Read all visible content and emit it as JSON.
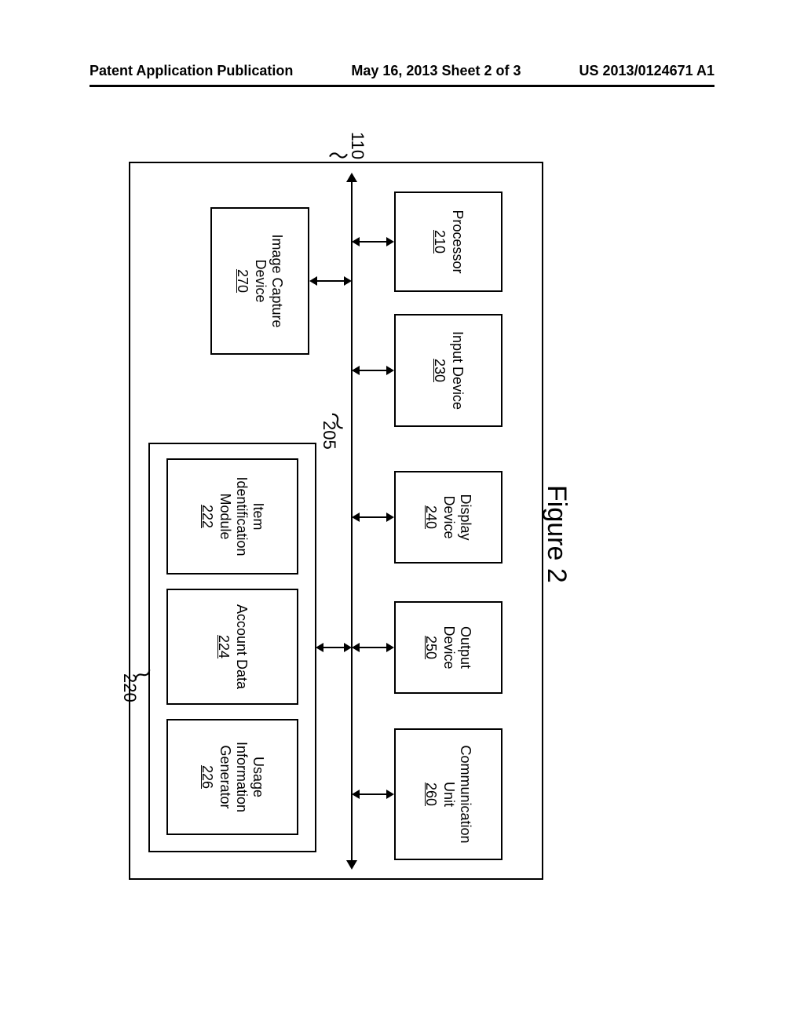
{
  "header": {
    "left": "Patent Application Publication",
    "center": "May 16, 2013  Sheet 2 of 3",
    "right": "US 2013/0124671 A1"
  },
  "figure": {
    "caption": "Figure 2",
    "outer_ref": "110",
    "bus_ref": "205",
    "memory_ref": "220",
    "blocks": {
      "processor": {
        "label": "Processor",
        "num": "210"
      },
      "input_device": {
        "label": "Input Device",
        "num": "230"
      },
      "display_device": {
        "label1": "Display",
        "label2": "Device",
        "num": "240"
      },
      "output_device": {
        "label1": "Output",
        "label2": "Device",
        "num": "250"
      },
      "communication_unit": {
        "label1": "Communication",
        "label2": "Unit",
        "num": "260"
      },
      "image_capture": {
        "label1": "Image Capture",
        "label2": "Device",
        "num": "270"
      },
      "item_identification": {
        "label1": "Item",
        "label2": "Identification",
        "label3": "Module",
        "num": "222"
      },
      "account_data": {
        "label": "Account Data",
        "num": "224"
      },
      "usage_info": {
        "label1": "Usage",
        "label2": "Information",
        "label3": "Generator",
        "num": "226"
      }
    }
  }
}
